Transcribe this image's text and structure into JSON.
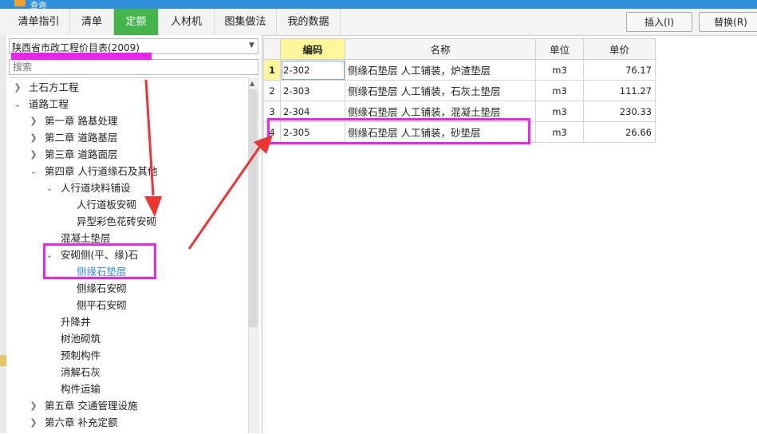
{
  "window": {
    "title": "查询"
  },
  "tabs": [
    {
      "label": "清单指引",
      "active": false
    },
    {
      "label": "清单",
      "active": false
    },
    {
      "label": "定额",
      "active": true
    },
    {
      "label": "人材机",
      "active": false
    },
    {
      "label": "图集做法",
      "active": false
    },
    {
      "label": "我的数据",
      "active": false
    }
  ],
  "toolbar": {
    "insert_label": "插入(I)",
    "replace_label": "替换(R)"
  },
  "library": {
    "selected": "陕西省市政工程价目表(2009)"
  },
  "search": {
    "placeholder": "搜索",
    "value": ""
  },
  "tree": {
    "nodes": [
      {
        "label": "土石方工程",
        "state": "collapsed"
      },
      {
        "label": "道路工程",
        "state": "expanded"
      },
      {
        "label": "第一章 路基处理",
        "state": "collapsed"
      },
      {
        "label": "第二章 道路基层",
        "state": "collapsed"
      },
      {
        "label": "第三章 道路面层",
        "state": "collapsed"
      },
      {
        "label": "第四章 人行道缘石及其他",
        "state": "expanded"
      },
      {
        "label": "人行道块料铺设",
        "state": "expanded"
      },
      {
        "label": "人行道板安砌",
        "state": "leaf"
      },
      {
        "label": "异型彩色花砖安砌",
        "state": "leaf"
      },
      {
        "label": "混凝土垫层",
        "state": "leaf"
      },
      {
        "label": "安砌侧(平、缘)石",
        "state": "expanded"
      },
      {
        "label": "侧缘石垫层",
        "state": "leaf-selected"
      },
      {
        "label": "侧缘石安砌",
        "state": "leaf"
      },
      {
        "label": "侧平石安砌",
        "state": "leaf"
      },
      {
        "label": "升降井",
        "state": "leaf"
      },
      {
        "label": "树池砌筑",
        "state": "leaf"
      },
      {
        "label": "预制构件",
        "state": "leaf"
      },
      {
        "label": "消解石灰",
        "state": "leaf"
      },
      {
        "label": "构件运输",
        "state": "leaf"
      },
      {
        "label": "第五章 交通管理设施",
        "state": "collapsed"
      },
      {
        "label": "第六章 补充定额",
        "state": "collapsed"
      }
    ]
  },
  "grid": {
    "columns": [
      "",
      "编码",
      "名称",
      "单位",
      "单价"
    ],
    "rows": [
      {
        "num": "1",
        "code": "2-302",
        "name": "侧缘石垫层 人工铺装，炉渣垫层",
        "unit": "m3",
        "price": "76.17"
      },
      {
        "num": "2",
        "code": "2-303",
        "name": "侧缘石垫层 人工铺装，石灰土垫层",
        "unit": "m3",
        "price": "111.27"
      },
      {
        "num": "3",
        "code": "2-304",
        "name": "侧缘石垫层 人工铺装，混凝土垫层",
        "unit": "m3",
        "price": "230.33"
      },
      {
        "num": "4",
        "code": "2-305",
        "name": "侧缘石垫层 人工铺装，砂垫层",
        "unit": "m3",
        "price": "26.66"
      }
    ]
  },
  "colors": {
    "active_tab": "#43b54a",
    "highlight": "#ee22ee",
    "arrow": "#ee3333",
    "selected_text": "#2d8be0",
    "header_sorted": "#fff59a"
  }
}
